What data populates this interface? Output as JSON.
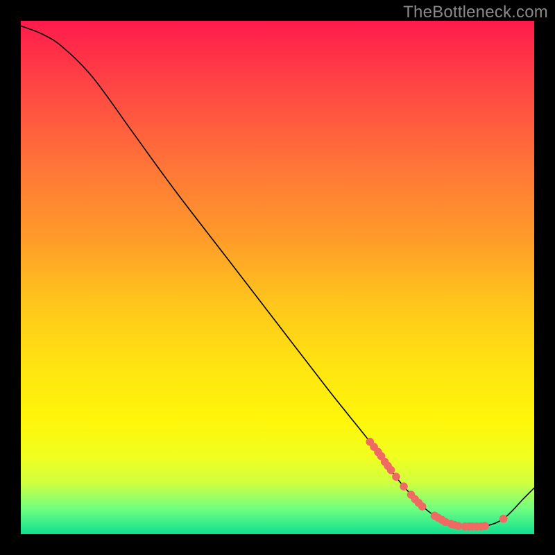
{
  "watermark": "TheBottleneck.com",
  "chart_data": {
    "type": "line",
    "title": "",
    "xlabel": "",
    "ylabel": "",
    "xlim": [
      0,
      100
    ],
    "ylim": [
      0,
      100
    ],
    "grid": false,
    "legend": false,
    "curve": [
      {
        "x": 0,
        "y": 99
      },
      {
        "x": 4,
        "y": 97.5
      },
      {
        "x": 8,
        "y": 95
      },
      {
        "x": 14,
        "y": 89
      },
      {
        "x": 22,
        "y": 78
      },
      {
        "x": 30,
        "y": 67
      },
      {
        "x": 40,
        "y": 54
      },
      {
        "x": 50,
        "y": 41
      },
      {
        "x": 60,
        "y": 28
      },
      {
        "x": 68,
        "y": 18
      },
      {
        "x": 74,
        "y": 10
      },
      {
        "x": 80,
        "y": 4
      },
      {
        "x": 86,
        "y": 1.5
      },
      {
        "x": 90,
        "y": 1.5
      },
      {
        "x": 94,
        "y": 3
      },
      {
        "x": 98,
        "y": 7
      },
      {
        "x": 100,
        "y": 9
      }
    ],
    "marker_clusters": [
      {
        "cx": 68.0,
        "cy": 18.0
      },
      {
        "cx": 68.8,
        "cy": 17.0
      },
      {
        "cx": 69.6,
        "cy": 16.0
      },
      {
        "cx": 70.2,
        "cy": 15.2
      },
      {
        "cx": 70.9,
        "cy": 14.1
      },
      {
        "cx": 71.5,
        "cy": 13.3
      },
      {
        "cx": 72.1,
        "cy": 12.5
      },
      {
        "cx": 73.1,
        "cy": 11.2
      },
      {
        "cx": 74.6,
        "cy": 9.3
      },
      {
        "cx": 76.0,
        "cy": 7.7
      },
      {
        "cx": 76.8,
        "cy": 6.8
      },
      {
        "cx": 77.5,
        "cy": 6.1
      },
      {
        "cx": 78.2,
        "cy": 5.4
      },
      {
        "cx": 80.6,
        "cy": 3.6
      },
      {
        "cx": 81.3,
        "cy": 3.2
      },
      {
        "cx": 82.0,
        "cy": 2.8
      },
      {
        "cx": 82.7,
        "cy": 2.4
      },
      {
        "cx": 83.8,
        "cy": 2.0
      },
      {
        "cx": 84.5,
        "cy": 1.8
      },
      {
        "cx": 85.2,
        "cy": 1.6
      },
      {
        "cx": 86.5,
        "cy": 1.5
      },
      {
        "cx": 87.3,
        "cy": 1.5
      },
      {
        "cx": 88.0,
        "cy": 1.5
      },
      {
        "cx": 88.8,
        "cy": 1.5
      },
      {
        "cx": 89.6,
        "cy": 1.5
      },
      {
        "cx": 90.4,
        "cy": 1.6
      },
      {
        "cx": 94.0,
        "cy": 3.0
      }
    ],
    "marker_color": "#ef6a63",
    "line_color": "#000000"
  }
}
